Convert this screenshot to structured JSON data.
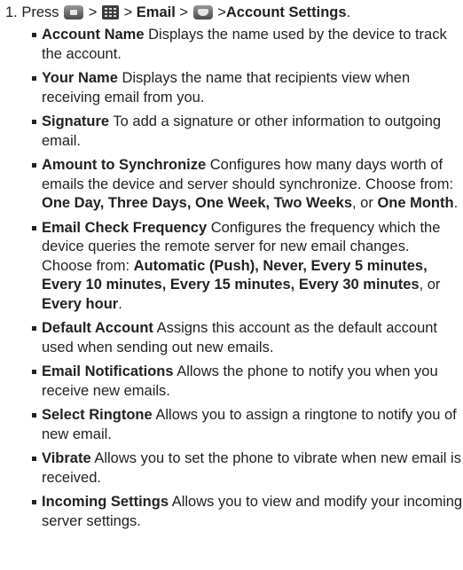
{
  "step": {
    "number": "1.",
    "press": "Press",
    "sep": ">",
    "email": "Email",
    "account_settings": "Account Settings",
    "end": "."
  },
  "items": [
    {
      "title": "Account Name",
      "text": " Displays the name used by the device to track the account."
    },
    {
      "title": "Your Name",
      "text": " Displays the name that recipients view when receiving email from you."
    },
    {
      "title": "Signature",
      "text": " To add a signature or other information to outgoing email."
    },
    {
      "title": "Amount to Synchronize",
      "text": " Configures how many days worth of emails the device and server should synchronize. Choose from: ",
      "options": "One Day, Three Days, One Week, Two Weeks",
      "or": ", or ",
      "last": "One Month",
      "end": "."
    },
    {
      "title": "Email Check Frequency",
      "text": " Configures the frequency which the device queries the remote server for new email changes. Choose from: ",
      "options": "Automatic (Push), Never, Every 5 minutes, Every 10 minutes, Every 15 minutes, Every 30 minutes",
      "or": ", or ",
      "last": "Every hour",
      "end": "."
    },
    {
      "title": "Default Account",
      "text": " Assigns this account as the default account used when sending out new emails."
    },
    {
      "title": "Email Notifications",
      "text": " Allows the phone to notify you when you receive new emails."
    },
    {
      "title": "Select Ringtone",
      "text": " Allows you to assign a ringtone to notify you of new email."
    },
    {
      "title": "Vibrate",
      "text": " Allows you to set the phone to vibrate when new email is received."
    },
    {
      "title": "Incoming Settings",
      "text": " Allows you to view and modify your incoming server settings."
    }
  ]
}
